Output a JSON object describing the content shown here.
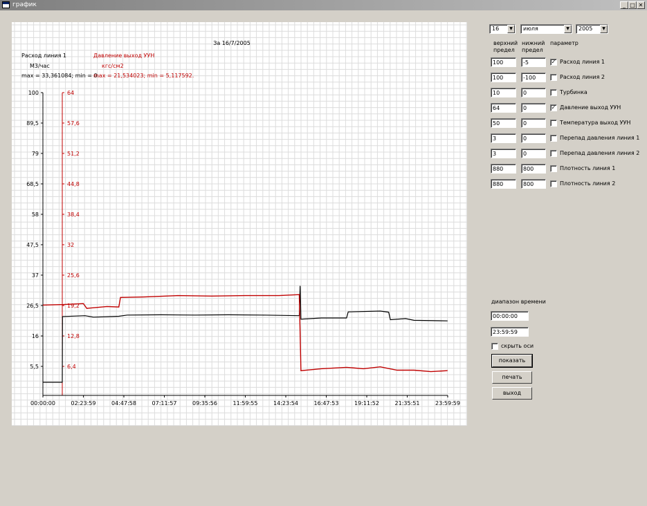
{
  "window": {
    "title": "график",
    "min_glyph": "_",
    "max_glyph": "□",
    "close_glyph": "✕"
  },
  "controls": {
    "day": "16",
    "month": "июля",
    "year": "2005",
    "col_upper": [
      "верхний",
      "предел"
    ],
    "col_lower": [
      "нижний",
      "предел"
    ],
    "col_param": "параметр",
    "params": [
      {
        "upper": "100",
        "lower": "-5",
        "label": "Расход линия 1",
        "checked": true
      },
      {
        "upper": "100",
        "lower": "-100",
        "label": "Расход линия 2",
        "checked": false
      },
      {
        "upper": "10",
        "lower": "0",
        "label": "Турбинка",
        "checked": false
      },
      {
        "upper": "64",
        "lower": "0",
        "label": "Давление выход УУН",
        "checked": true
      },
      {
        "upper": "50",
        "lower": "0",
        "label": "Температура выход УУН",
        "checked": false
      },
      {
        "upper": "3",
        "lower": "0",
        "label": "Перепад давления линия 1",
        "checked": false
      },
      {
        "upper": "3",
        "lower": "0",
        "label": "Перепад давления линия 2",
        "checked": false
      },
      {
        "upper": "880",
        "lower": "800",
        "label": "Плотность линия 1",
        "checked": false
      },
      {
        "upper": "880",
        "lower": "800",
        "label": "Плотность линия 2",
        "checked": false
      }
    ],
    "time_range_label": "диапазон времени",
    "time_from": "00:00:00",
    "time_to": "23:59:59",
    "hide_axes_label": "скрыть оси",
    "hide_axes_checked": false,
    "show_button": "показать",
    "print_button": "печать",
    "exit_button": "выход"
  },
  "colors": {
    "series1": "#000000",
    "series2": "#c00000",
    "grid": "#dcdcdc",
    "background": "#ffffff"
  },
  "chart_data": {
    "type": "line",
    "title": "За 16/7/2005",
    "x_ticks": [
      "00:00:00",
      "02:23:59",
      "04:47:58",
      "07:11:57",
      "09:35:56",
      "11:59:55",
      "14:23:54",
      "16:47:53",
      "19:11:52",
      "21:35:51",
      "23:59:59"
    ],
    "xlim_hours": [
      0,
      24
    ],
    "series": [
      {
        "name": "Расход линия 1",
        "unit": "М3/час",
        "stats": "max = 33,361084; min = 0.",
        "axis_ticks": [
          "100",
          "89,5",
          "79",
          "68,5",
          "58",
          "47,5",
          "37",
          "26,5",
          "16",
          "5,5"
        ],
        "ylim": [
          -5,
          100
        ],
        "points": [
          [
            0,
            0
          ],
          [
            1.15,
            0
          ],
          [
            1.16,
            22.7
          ],
          [
            2.5,
            23
          ],
          [
            3.0,
            22.5
          ],
          [
            4.5,
            22.8
          ],
          [
            5.0,
            23.2
          ],
          [
            7.0,
            23.3
          ],
          [
            9.0,
            23.2
          ],
          [
            11.0,
            23.3
          ],
          [
            13.0,
            23.2
          ],
          [
            15.2,
            23.0
          ],
          [
            15.25,
            33.3
          ],
          [
            15.3,
            21.8
          ],
          [
            16.5,
            22.2
          ],
          [
            18.0,
            22.2
          ],
          [
            18.1,
            24.3
          ],
          [
            20.0,
            24.6
          ],
          [
            20.5,
            24.2
          ],
          [
            20.6,
            21.6
          ],
          [
            21.5,
            22.0
          ],
          [
            22.0,
            21.4
          ],
          [
            23.99,
            21.2
          ]
        ]
      },
      {
        "name": "Давление выход УУН",
        "unit": "кгс/см2",
        "stats": "max = 21,534023; min = 5,117592.",
        "axis_ticks": [
          "64",
          "57,6",
          "51,2",
          "44,8",
          "38,4",
          "32",
          "25,6",
          "19,2",
          "12,8",
          "6,4"
        ],
        "ylim": [
          0,
          64
        ],
        "points": [
          [
            0,
            19.3
          ],
          [
            1.2,
            19.4
          ],
          [
            2.4,
            19.6
          ],
          [
            2.6,
            18.6
          ],
          [
            3.8,
            19.0
          ],
          [
            4.5,
            18.9
          ],
          [
            4.6,
            20.9
          ],
          [
            6.0,
            21.0
          ],
          [
            8.0,
            21.3
          ],
          [
            10.0,
            21.2
          ],
          [
            12.0,
            21.3
          ],
          [
            14.0,
            21.3
          ],
          [
            15.2,
            21.5
          ],
          [
            15.3,
            5.5
          ],
          [
            16.5,
            5.9
          ],
          [
            18.0,
            6.2
          ],
          [
            19.0,
            5.9
          ],
          [
            20.0,
            6.3
          ],
          [
            21.0,
            5.6
          ],
          [
            22.0,
            5.6
          ],
          [
            23.0,
            5.3
          ],
          [
            23.99,
            5.5
          ]
        ]
      }
    ],
    "grid": true
  }
}
